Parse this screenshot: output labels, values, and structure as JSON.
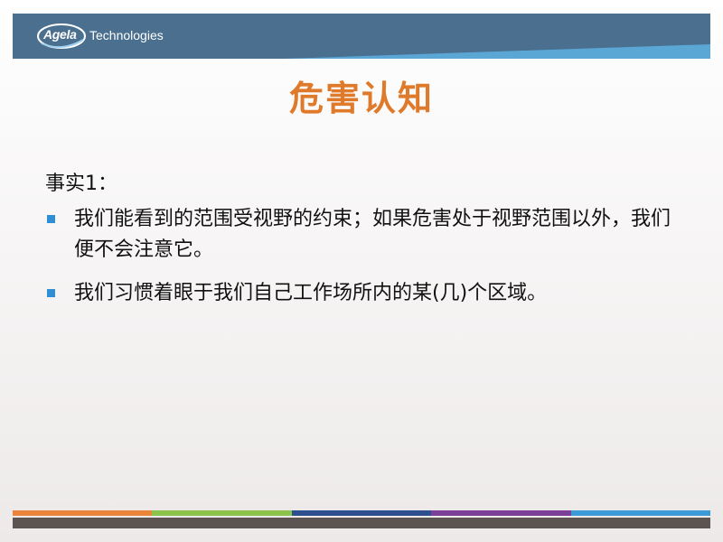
{
  "header": {
    "logo_text": "Agela",
    "brand_text": "Technologies",
    "band_color": "#4a6f8f",
    "accent_color": "#5aa7d6"
  },
  "slide": {
    "title": "危害认知",
    "title_color": "#e07a2b",
    "fact_label": "事实1：",
    "bullets": [
      {
        "text": "我们能看到的范围受视野的约束；如果危害处于视野范围以外，我们便不会注意它。"
      },
      {
        "text": "我们习惯着眼于我们自己工作场所内的某(几)个区域。"
      }
    ],
    "bullet_color": "#2f8fd6"
  },
  "footer": {
    "stripe_colors": [
      "#e9843a",
      "#8cc34a",
      "#2e4f8f",
      "#7b3f98",
      "#3c9bd6"
    ],
    "bar_color": "#5b5450"
  }
}
